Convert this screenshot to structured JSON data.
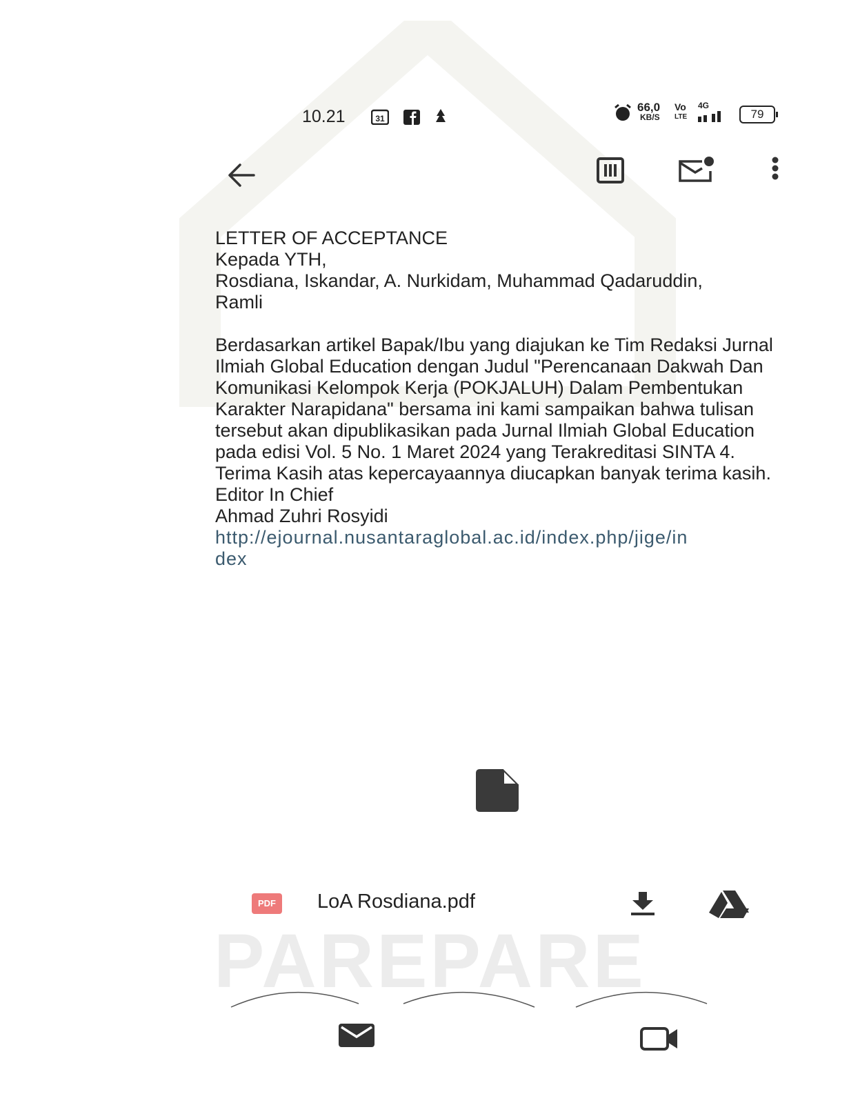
{
  "status_bar": {
    "time": "10.21",
    "calendar_day": "31",
    "net_speed_value": "66,0",
    "net_speed_unit": "KB/S",
    "volte": "Vo",
    "volte_sub": "LTE",
    "network": "4G",
    "battery": "79"
  },
  "email": {
    "subject": "LETTER OF ACCEPTANCE",
    "greeting": "Kepada YTH,",
    "recipients": "Rosdiana, Iskandar, A. Nurkidam, Muhammad Qadaruddin, Ramli",
    "body": "Berdasarkan artikel Bapak/Ibu yang diajukan ke Tim Redaksi Jurnal Ilmiah Global Education dengan Judul \"Perencanaan Dakwah Dan Komunikasi Kelompok Kerja (POKJALUH) Dalam Pembentukan Karakter Narapidana\" bersama ini kami sampaikan bahwa tulisan tersebut akan dipublikasikan pada Jurnal Ilmiah Global Education pada edisi Vol. 5 No. 1 Maret 2024 yang Terakreditasi SINTA 4.",
    "thanks": "Terima Kasih atas kepercayaannya diucapkan banyak terima kasih.",
    "signature_title": "Editor In Chief",
    "signature_name": "Ahmad Zuhri Rosyidi",
    "link": "http://ejournal.nusantaraglobal.ac.id/index.php/jige/index"
  },
  "attachment": {
    "badge": "PDF",
    "filename": "LoA Rosdiana.pdf"
  },
  "watermark": {
    "text": "PAREPARE"
  },
  "icons": {
    "back": "arrow-left-icon",
    "delete": "trash-icon",
    "mark_unread": "mail-unread-icon",
    "more": "more-vertical-icon",
    "download": "download-icon",
    "drive": "drive-icon",
    "mail_tab": "mail-icon",
    "meet_tab": "video-icon",
    "file": "file-icon"
  },
  "colors": {
    "text": "#222222",
    "link": "#3b5a6e",
    "pdf_badge": "#ee7a7a",
    "icon": "#333333"
  }
}
